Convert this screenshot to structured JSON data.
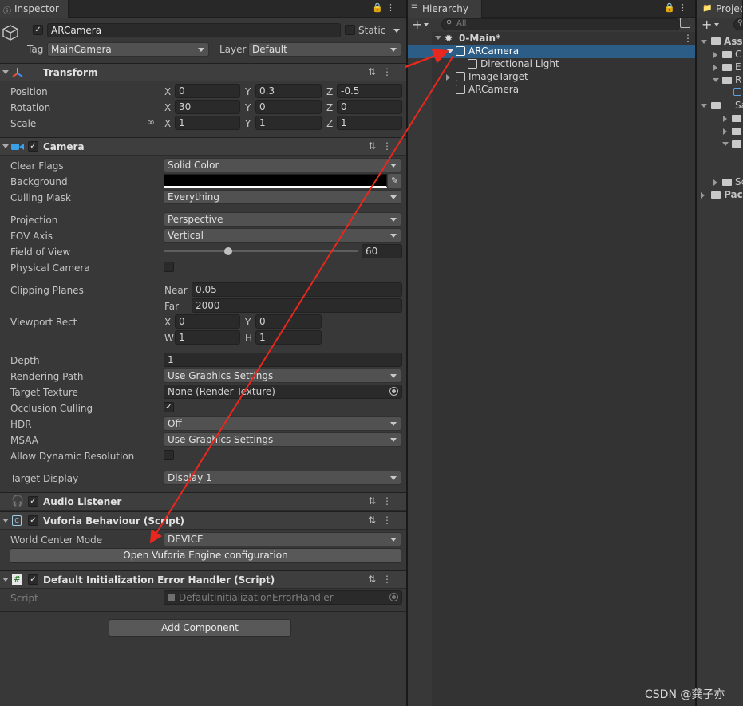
{
  "inspector": {
    "tab": "Inspector",
    "object_name": "ARCamera",
    "static_label": "Static",
    "tag_label": "Tag",
    "tag_value": "MainCamera",
    "layer_label": "Layer",
    "layer_value": "Default",
    "transform": {
      "title": "Transform",
      "position_label": "Position",
      "rotation_label": "Rotation",
      "scale_label": "Scale",
      "axis_x": "X",
      "axis_y": "Y",
      "axis_z": "Z",
      "position": [
        "0",
        "0.3",
        "-0.5"
      ],
      "rotation": [
        "30",
        "0",
        "0"
      ],
      "scale": [
        "1",
        "1",
        "1"
      ]
    },
    "camera": {
      "title": "Camera",
      "clear_flags_label": "Clear Flags",
      "clear_flags": "Solid Color",
      "background_label": "Background",
      "culling_mask_label": "Culling Mask",
      "culling_mask": "Everything",
      "projection_label": "Projection",
      "projection": "Perspective",
      "fov_axis_label": "FOV Axis",
      "fov_axis": "Vertical",
      "fov_label": "Field of View",
      "fov": "60",
      "fov_slider_fraction": 0.33,
      "physical_label": "Physical Camera",
      "clipping_label": "Clipping Planes",
      "near_label": "Near",
      "near": "0.05",
      "far_label": "Far",
      "far": "2000",
      "viewport_label": "Viewport Rect",
      "vx": "0",
      "vy": "0",
      "vw": "1",
      "vh": "1",
      "w_label": "W",
      "h_label": "H",
      "depth_label": "Depth",
      "depth": "1",
      "rendering_path_label": "Rendering Path",
      "rendering_path": "Use Graphics Settings",
      "target_texture_label": "Target Texture",
      "target_texture": "None (Render Texture)",
      "occlusion_label": "Occlusion Culling",
      "hdr_label": "HDR",
      "hdr": "Off",
      "msaa_label": "MSAA",
      "msaa": "Use Graphics Settings",
      "dynamic_res_label": "Allow Dynamic Resolution",
      "target_display_label": "Target Display",
      "target_display": "Display 1"
    },
    "audio_listener_title": "Audio Listener",
    "vuforia": {
      "title": "Vuforia Behaviour (Script)",
      "world_center_label": "World Center Mode",
      "world_center": "DEVICE",
      "open_config_button": "Open Vuforia Engine configuration"
    },
    "error_handler": {
      "title": "Default Initialization Error Handler (Script)",
      "script_label": "Script",
      "script_value": "DefaultInitializationErrorHandler"
    },
    "add_component_button": "Add Component"
  },
  "hierarchy": {
    "tab": "Hierarchy",
    "search_placeholder": "All",
    "scene": "0-Main*",
    "items": [
      "ARCamera",
      "Directional Light",
      "ImageTarget",
      "ARCamera"
    ]
  },
  "project": {
    "tab": "Projec",
    "items": [
      "Ass",
      "C",
      "E",
      "R",
      "Sa",
      "Sc",
      "Pac"
    ]
  },
  "watermark": "CSDN @龚子亦",
  "colors": {
    "accent": "#2c5d87",
    "arrow": "#e8281e",
    "background": "#383838"
  }
}
